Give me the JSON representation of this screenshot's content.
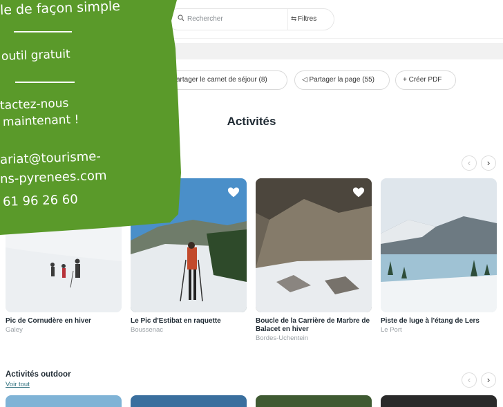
{
  "search": {
    "placeholder": "Rechercher",
    "filters_label": "Filtres"
  },
  "share": {
    "carnet_label": "artager le carnet de séjour (8)",
    "page_label": "Partager la page (55)",
    "pdf_label": "+ Créer PDF"
  },
  "section": {
    "title": "Activités"
  },
  "cards": [
    {
      "title": "Pic de Cornudère en hiver",
      "subtitle": "Galey",
      "favorite": false
    },
    {
      "title": "Le Pic d'Estibat en raquette",
      "subtitle": "Boussenac",
      "favorite": true
    },
    {
      "title": "Boucle de la Carrière de Marbre de Balacet en hiver",
      "subtitle": "Bordes-Uchentein",
      "favorite": true
    },
    {
      "title": "Piste de luge à l'étang de Lers",
      "subtitle": "Le Port",
      "favorite": false
    }
  ],
  "outdoor": {
    "title": "Activités outdoor",
    "see_all": "Voir tout"
  },
  "promo": {
    "line1": "le de façon simple",
    "line2": "outil gratuit",
    "line3": "tactez-nous",
    "line4": "maintenant !",
    "line5": "ariat@tourisme-",
    "line6": "ns-pyrenees.com",
    "line7": "61 96 26 60",
    "color": "#5a9a2a"
  },
  "icons": {
    "carousel_prev": "chevron-left-icon",
    "carousel_next": "chevron-right-icon",
    "favorite": "heart-icon"
  }
}
